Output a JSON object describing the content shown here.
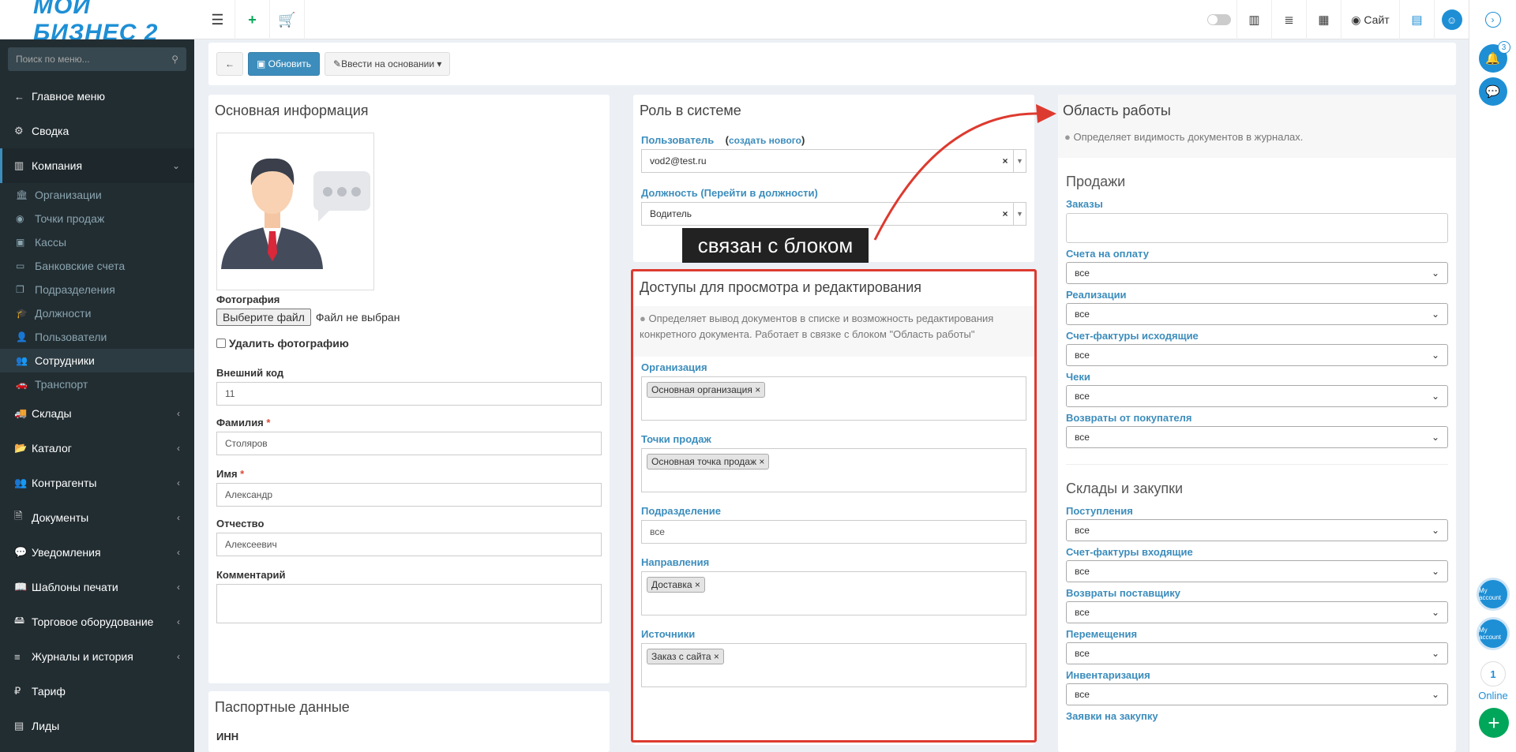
{
  "header": {
    "logo": "МОЙ БИЗНЕС 2",
    "site_label": "Сайт"
  },
  "sidebar": {
    "search_placeholder": "Поиск по меню...",
    "items": [
      {
        "label": "Главное меню"
      },
      {
        "label": "Сводка"
      },
      {
        "label": "Компания"
      },
      {
        "label": "Склады"
      },
      {
        "label": "Каталог"
      },
      {
        "label": "Контрагенты"
      },
      {
        "label": "Документы"
      },
      {
        "label": "Уведомления"
      },
      {
        "label": "Шаблоны печати"
      },
      {
        "label": "Торговое оборудование"
      },
      {
        "label": "Журналы и история"
      },
      {
        "label": "Тариф"
      },
      {
        "label": "Лиды"
      }
    ],
    "subitems": [
      {
        "label": "Организации"
      },
      {
        "label": "Точки продаж"
      },
      {
        "label": "Кассы"
      },
      {
        "label": "Банковские счета"
      },
      {
        "label": "Подразделения"
      },
      {
        "label": "Должности"
      },
      {
        "label": "Пользователи"
      },
      {
        "label": "Сотрудники"
      },
      {
        "label": "Транспорт"
      }
    ]
  },
  "toolbar": {
    "refresh": "Обновить",
    "based_on": "Ввести на основании"
  },
  "basic": {
    "title": "Основная информация",
    "photo_label": "Фотография",
    "file_button": "Выберите файл",
    "file_status": "Файл не выбран",
    "delete_photo": "Удалить фотографию",
    "ext_code_label": "Внешний код",
    "ext_code": "11",
    "surname_label": "Фамилия",
    "surname": "Столяров",
    "name_label": "Имя",
    "name": "Александр",
    "patronymic_label": "Отчество",
    "patronymic": "Алексеевич",
    "comment_label": "Комментарий",
    "passport_title": "Паспортные данные",
    "inn_label": "ИНН"
  },
  "role": {
    "title": "Роль в системе",
    "user_label": "Пользователь",
    "create_new": "создать нового",
    "user_value": "vod2@test.ru",
    "position_label": "Должность (Перейти в должности)",
    "position_value": "Водитель"
  },
  "callout": {
    "text": "связан с блоком"
  },
  "access": {
    "title": "Доступы для просмотра и редактирования",
    "hint": "Определяет вывод документов в списке и возможность редактирования конкретного документа. Работает в связке с блоком \"Область работы\"",
    "org_label": "Организация",
    "org_tag": "Основная организация",
    "pos_label": "Точки продаж",
    "pos_tag": "Основная точка продаж",
    "dept_label": "Подразделение",
    "dept_value": "все",
    "dir_label": "Направления",
    "dir_tag": "Доставка",
    "src_label": "Источники",
    "src_tag": "Заказ с сайта"
  },
  "workarea": {
    "title": "Область работы",
    "hint": "Определяет видимость документов в журналах.",
    "sales_title": "Продажи",
    "orders_label": "Заказы",
    "invoices_label": "Счета на оплату",
    "invoices": "все",
    "sales_label": "Реализации",
    "sales": "все",
    "outinv_label": "Счет-фактуры исходящие",
    "outinv": "все",
    "checks_label": "Чеки",
    "checks": "все",
    "returns_label": "Возвраты от покупателя",
    "returns": "все",
    "wh_title": "Склады и закупки",
    "receipts_label": "Поступления",
    "receipts": "все",
    "ininv_label": "Счет-фактуры входящие",
    "ininv": "все",
    "supret_label": "Возвраты поставщику",
    "supret": "все",
    "moves_label": "Перемещения",
    "moves": "все",
    "inventory_label": "Инвентаризация",
    "inventory": "все",
    "purchase_label": "Заявки на закупку"
  },
  "rightbar": {
    "notif_count": "3",
    "acct_label": "My account",
    "online_count": "1",
    "online_label": "Online"
  }
}
